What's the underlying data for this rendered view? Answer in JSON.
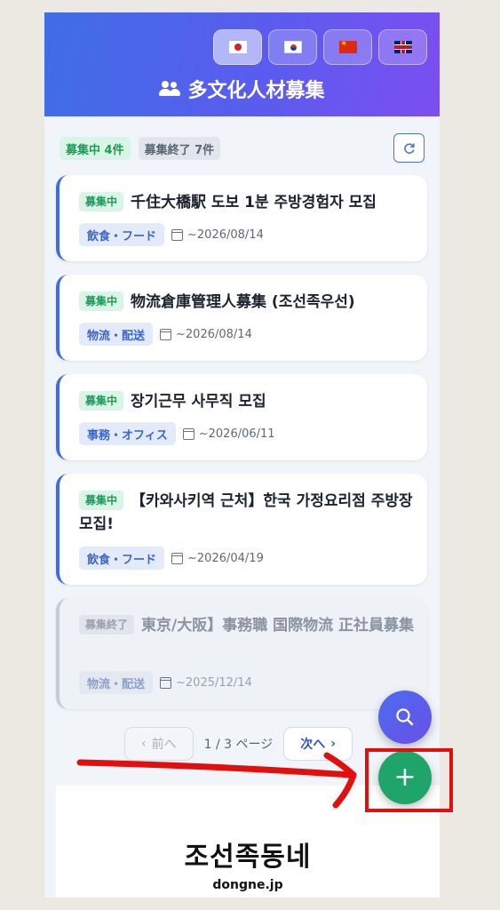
{
  "header": {
    "title": "多文化人材募集",
    "languages": [
      {
        "name": "japanese",
        "active": true
      },
      {
        "name": "korean",
        "active": false
      },
      {
        "name": "chinese",
        "active": false
      },
      {
        "name": "english",
        "active": false
      }
    ]
  },
  "stats": {
    "open": "募集中 4件",
    "closed": "募集終了 7件"
  },
  "jobs": [
    {
      "status": "募集中",
      "title": "千住大橋駅 도보 1분 주방경험자 모집",
      "category": "飲食・フード",
      "deadline": "~2026/08/14"
    },
    {
      "status": "募集中",
      "title": "物流倉庫管理人募集 (조선족우선)",
      "category": "物流・配送",
      "deadline": "~2026/08/14"
    },
    {
      "status": "募集中",
      "title": "장기근무 사무직 모집",
      "category": "事務・オフィス",
      "deadline": "~2026/06/11"
    },
    {
      "status": "募集中",
      "title": "【카와사키역 근처】한국 가정요리점 주방장 모집!",
      "category": "飲食・フード",
      "deadline": "~2026/04/19"
    },
    {
      "status": "募集終了",
      "title": "東京/大阪】事務職 国際物流 正社員募集",
      "category": "物流・配送",
      "deadline": "~2025/12/14"
    }
  ],
  "pagination": {
    "prev_label": "前へ",
    "info": "1 / 3 ページ",
    "next_label": "次へ"
  },
  "footer": {
    "logo_text": "조선족동네",
    "domain": "dongne.jp"
  },
  "colors": {
    "accent": "#3b6ee6",
    "open_green": "#1e9a5a",
    "fab_add": "#1fa56a",
    "annotation_red": "#e20f0f"
  }
}
